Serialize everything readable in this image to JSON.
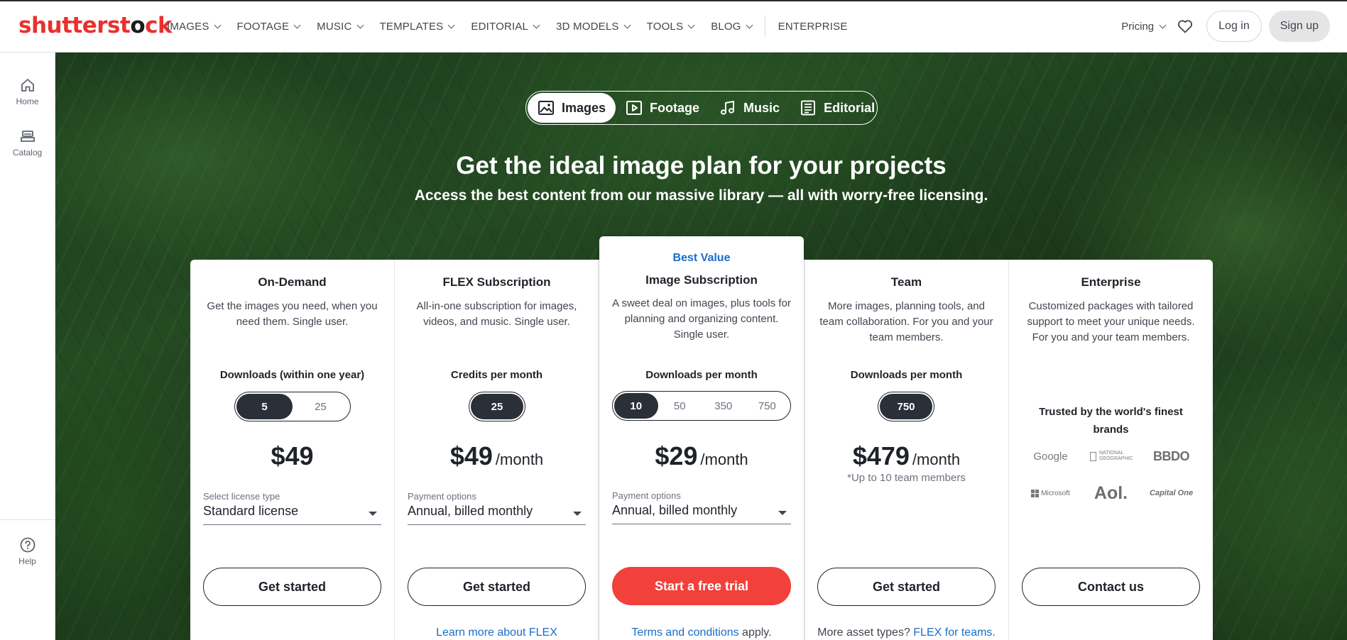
{
  "brand": {
    "logo_red": "shutterst",
    "logo_dark": "ck",
    "logo_o": "o",
    "accent_color": "#f2403b",
    "link_color": "#1a6dc6"
  },
  "nav": {
    "items": [
      {
        "label": "IMAGES"
      },
      {
        "label": "FOOTAGE"
      },
      {
        "label": "MUSIC"
      },
      {
        "label": "TEMPLATES"
      },
      {
        "label": "EDITORIAL"
      },
      {
        "label": "3D MODELS"
      },
      {
        "label": "TOOLS"
      },
      {
        "label": "BLOG"
      }
    ],
    "enterprise": "ENTERPRISE",
    "pricing": "Pricing",
    "login": "Log in",
    "signup": "Sign up"
  },
  "sidebar": {
    "home": "Home",
    "catalog": "Catalog",
    "help": "Help"
  },
  "media_tabs": [
    {
      "label": "Images",
      "icon": "image-icon",
      "active": true
    },
    {
      "label": "Footage",
      "icon": "video-icon",
      "active": false
    },
    {
      "label": "Music",
      "icon": "music-note-icon",
      "active": false
    },
    {
      "label": "Editorial",
      "icon": "document-icon",
      "active": false
    }
  ],
  "hero": {
    "title": "Get the ideal image plan for your projects",
    "subtitle": "Access the best content from our massive library — all with worry-free licensing."
  },
  "plans": {
    "ondemand": {
      "name": "On-Demand",
      "desc": "Get the images you need, when you need them. Single user.",
      "unit_label": "Downloads (within one year)",
      "options": [
        "5",
        "25"
      ],
      "selected": "5",
      "price": "$49",
      "select_label": "Select license type",
      "select_value": "Standard license",
      "cta": "Get started"
    },
    "flex": {
      "name": "FLEX Subscription",
      "desc": "All-in-one subscription for images, videos, and music. Single user.",
      "unit_label": "Credits per month",
      "options": [
        "25"
      ],
      "selected": "25",
      "price": "$49",
      "per": "/month",
      "select_label": "Payment options",
      "select_value": "Annual, billed monthly",
      "cta": "Get started",
      "foot_link": "Learn more about FLEX"
    },
    "image_sub": {
      "badge": "Best Value",
      "name": "Image Subscription",
      "desc": "A sweet deal on images, plus tools for planning and organizing content. Single user.",
      "unit_label": "Downloads per month",
      "options": [
        "10",
        "50",
        "350",
        "750"
      ],
      "selected": "10",
      "price": "$29",
      "per": "/month",
      "select_label": "Payment options",
      "select_value": "Annual, billed monthly",
      "cta": "Start a free trial",
      "foot_link": "Terms and conditions",
      "foot_text": " apply."
    },
    "team": {
      "name": "Team",
      "desc": "More images, planning tools, and team collaboration. For you and your team members.",
      "unit_label": "Downloads per month",
      "options": [
        "750"
      ],
      "selected": "750",
      "price": "$479",
      "per": "/month",
      "note": "*Up to 10 team members",
      "cta": "Get started",
      "foot_text": "More asset types? ",
      "foot_link": "FLEX for teams."
    },
    "enterprise": {
      "name": "Enterprise",
      "desc": "Customized packages with tailored support to meet your unique needs. For you and your team members.",
      "trusted": "Trusted by the world's finest brands",
      "brands": [
        "Google",
        "NATIONAL GEOGRAPHIC",
        "BBDO",
        "Microsoft",
        "Aol.",
        "Capital One"
      ],
      "cta": "Contact us"
    }
  }
}
